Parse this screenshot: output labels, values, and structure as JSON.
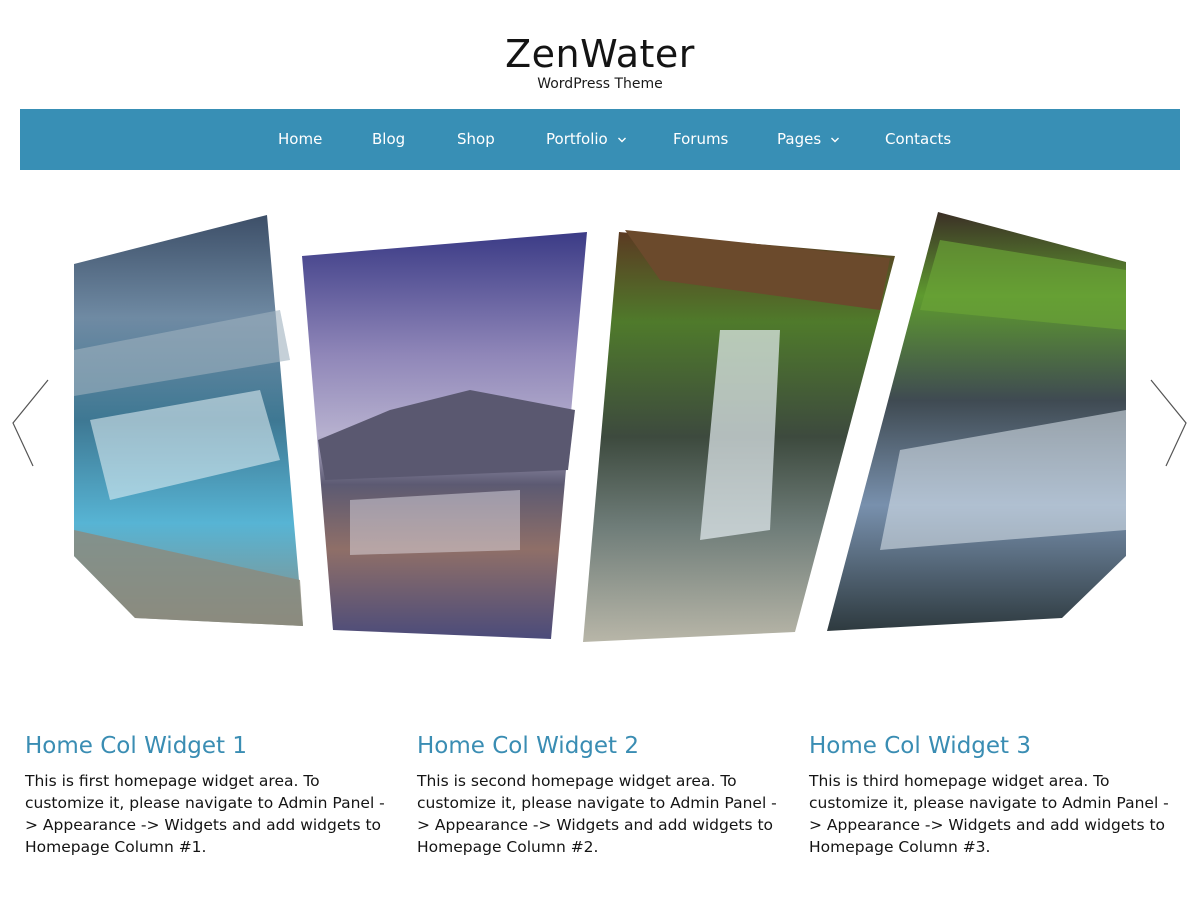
{
  "site": {
    "title": "ZenWater",
    "tagline": "WordPress Theme"
  },
  "nav": {
    "items": [
      {
        "label": "Home"
      },
      {
        "label": "Blog"
      },
      {
        "label": "Shop"
      },
      {
        "label": "Portfolio",
        "has_dropdown": true
      },
      {
        "label": "Forums"
      },
      {
        "label": "Pages",
        "has_dropdown": true
      },
      {
        "label": "Contacts"
      }
    ]
  },
  "slider": {
    "slides": [
      {
        "subject": "glacial waterfall"
      },
      {
        "subject": "mountain waterfall"
      },
      {
        "subject": "forest waterfall"
      },
      {
        "subject": "cascading waterfall"
      }
    ],
    "prev_icon": "chevron-left-icon",
    "next_icon": "chevron-right-icon"
  },
  "widgets": [
    {
      "title": "Home Col Widget 1",
      "text": "This is first homepage widget area. To customize it, please navigate to Admin Panel -> Appearance -> Widgets and add widgets to Homepage Column #1."
    },
    {
      "title": "Home Col Widget 2",
      "text": "This is second homepage widget area. To customize it, please navigate to Admin Panel -> Appearance -> Widgets and add widgets to Homepage Column #2."
    },
    {
      "title": "Home Col Widget 3",
      "text": "This is third homepage widget area. To customize it, please navigate to Admin Panel -> Appearance -> Widgets and add widgets to Homepage Column #3."
    }
  ],
  "colors": {
    "nav_background": "#388fb5",
    "widget_title": "#3a8db3"
  }
}
